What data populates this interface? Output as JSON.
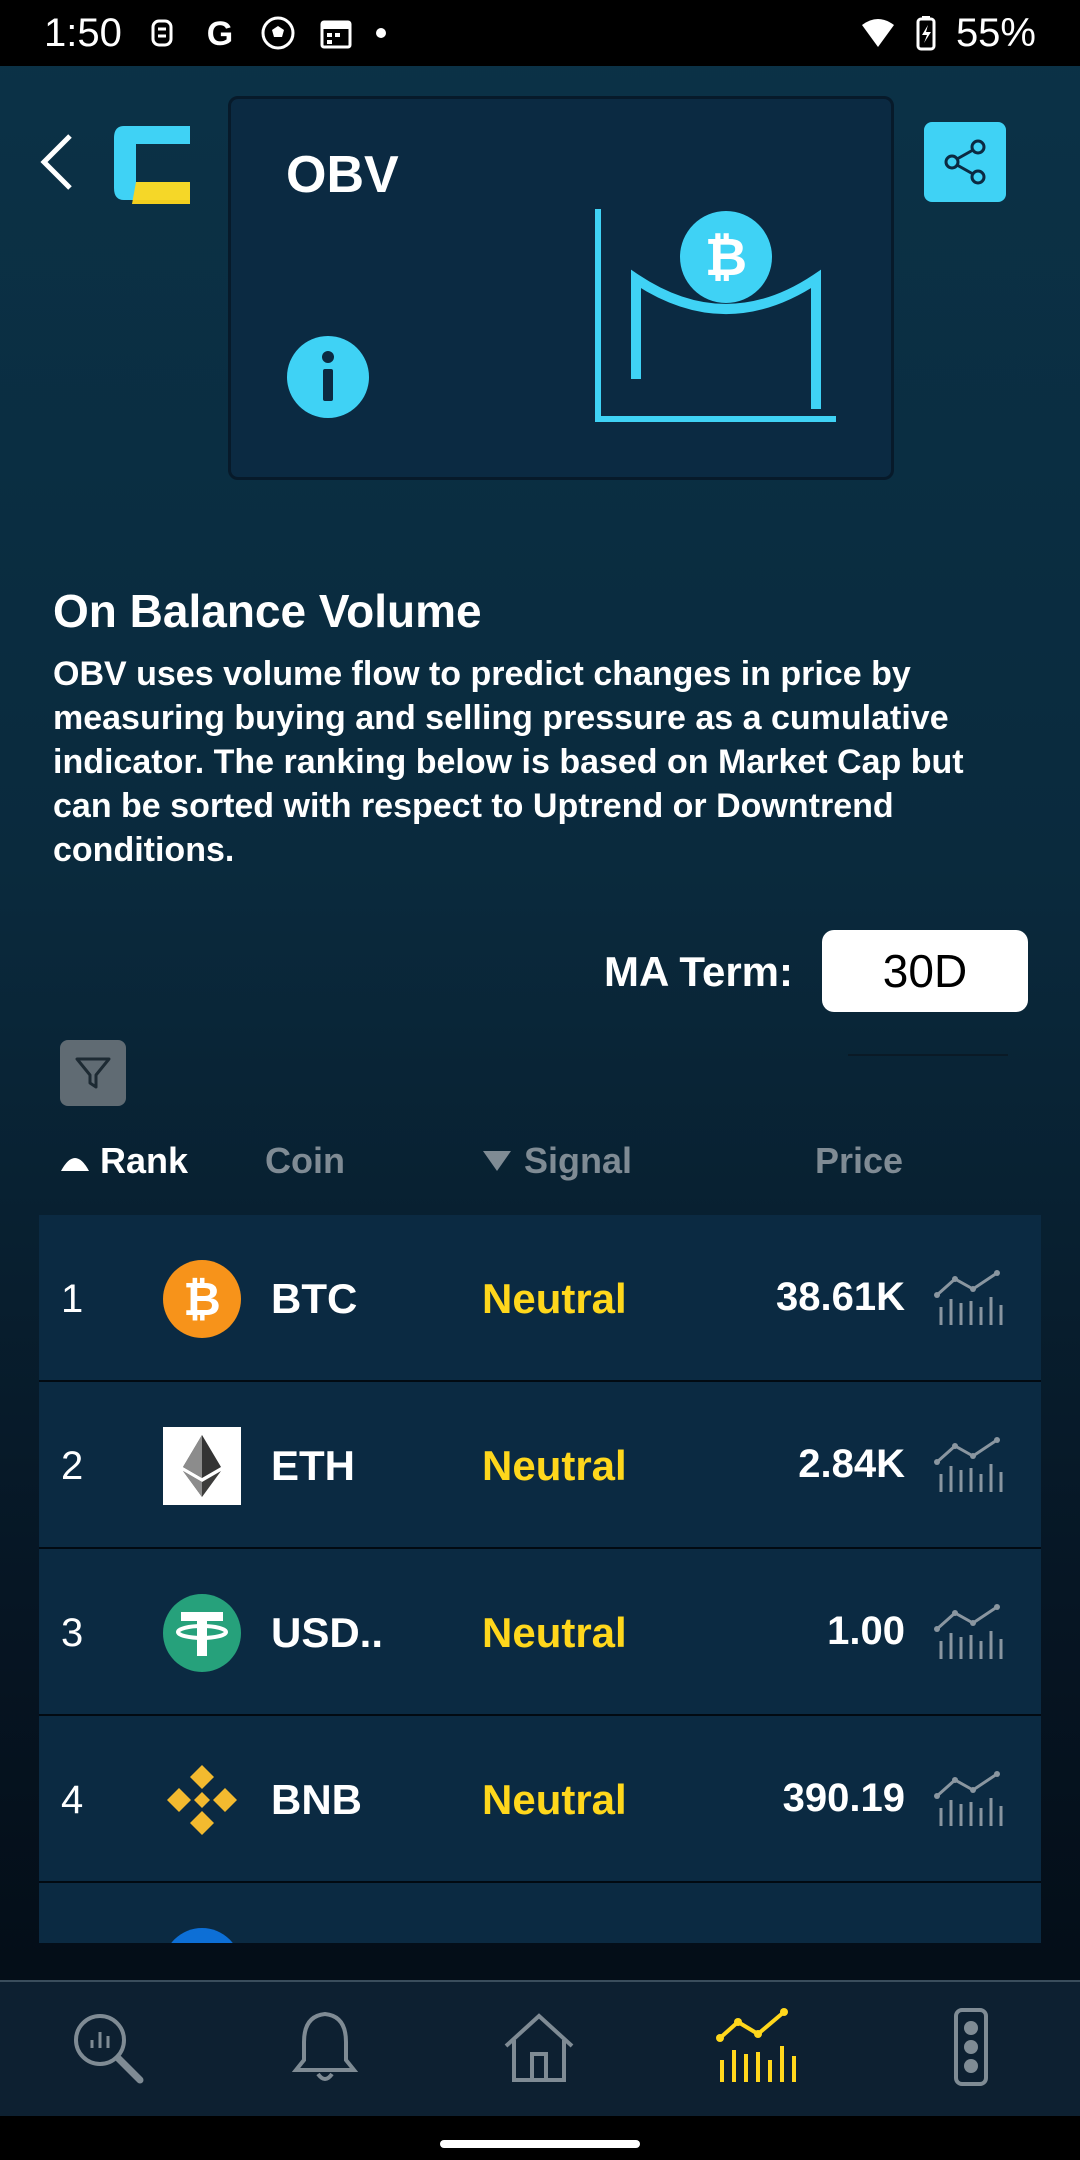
{
  "status_bar": {
    "time": "1:50",
    "battery": "55%",
    "icons": [
      "notification-icon",
      "google-icon",
      "soccer-icon",
      "calendar-icon",
      "dot-icon",
      "wifi-icon",
      "battery-icon"
    ]
  },
  "header": {
    "back_icon": "chevron-left-icon",
    "logo_icon": "app-logo",
    "share_icon": "share-icon"
  },
  "card": {
    "title": "OBV",
    "info_icon": "info-icon",
    "graphic_icon": "bitcoin-volume-icon"
  },
  "section": {
    "title": "On Balance Volume",
    "description": "OBV uses volume flow to predict changes in price by measuring buying and selling pressure as a cumulative indicator. The ranking below is based on Market Cap but can be sorted with respect to Uptrend or Downtrend conditions."
  },
  "ma_term": {
    "label": "MA Term:",
    "value": "30D"
  },
  "table": {
    "headers": {
      "rank": "Rank",
      "coin": "Coin",
      "signal": "Signal",
      "price": "Price"
    },
    "rows": [
      {
        "rank": "1",
        "symbol": "BTC",
        "signal": "Neutral",
        "price": "38.61K",
        "icon": "bitcoin-icon"
      },
      {
        "rank": "2",
        "symbol": "ETH",
        "signal": "Neutral",
        "price": "2.84K",
        "icon": "ethereum-icon"
      },
      {
        "rank": "3",
        "symbol": "USD..",
        "signal": "Neutral",
        "price": "1.00",
        "icon": "tether-icon"
      },
      {
        "rank": "4",
        "symbol": "BNB",
        "signal": "Neutral",
        "price": "390.19",
        "icon": "bnb-icon"
      }
    ]
  },
  "bottom_nav": {
    "items": [
      "analytics-search-icon",
      "bell-icon",
      "home-icon",
      "indicator-chart-icon",
      "traffic-light-icon"
    ],
    "active": "indicator-chart-icon"
  },
  "colors": {
    "accent": "#3fd2f5",
    "signal_neutral": "#ffd71c",
    "card_bg": "#0b2a42",
    "active_nav": "#ffd71c"
  }
}
